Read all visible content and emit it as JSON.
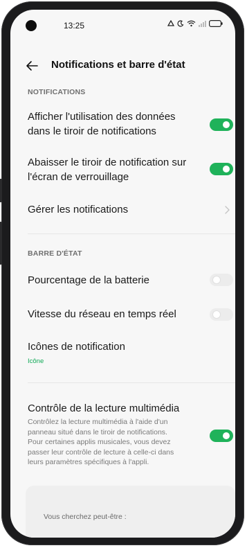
{
  "status_bar": {
    "time": "13:25"
  },
  "header": {
    "back_icon": "arrow-left-icon",
    "title": "Notifications et barre d'état"
  },
  "notifications_section": {
    "label": "NOTIFICATIONS",
    "items": [
      {
        "label_line1": "Afficher l'utilisation des données",
        "label_line2": "dans le tiroir de notifications",
        "toggle": true
      },
      {
        "label_line1": "Abaisser le tiroir de notification sur",
        "label_line2": "l'écran de verrouillage",
        "toggle": true
      },
      {
        "label": "Gérer les notifications",
        "has_chevron": true
      }
    ]
  },
  "status_bar_section": {
    "label": "BARRE D'ÉTAT",
    "items": [
      {
        "label": "Pourcentage de la batterie",
        "toggle": false
      },
      {
        "label": "Vitesse du réseau en temps réel",
        "toggle": false
      },
      {
        "label": "Icônes de notification",
        "value": "Icône"
      }
    ]
  },
  "media_section": {
    "label": "Contrôle de la lecture multimédia",
    "description_lines": [
      "Contrôlez la lecture multimédia à l'aide d'un",
      "panneau situé dans le tiroir de notifications.",
      "Pour certaines applis musicales, vous devez",
      "passer leur contrôle de lecture à celle-ci dans",
      "leurs paramètres spécifiques à l'appli."
    ],
    "toggle": true
  },
  "suggestions": {
    "label": "Vous cherchez peut-être :"
  },
  "colors": {
    "accent_green": "#1fb25a",
    "sub_value_green": "#0fa956"
  }
}
